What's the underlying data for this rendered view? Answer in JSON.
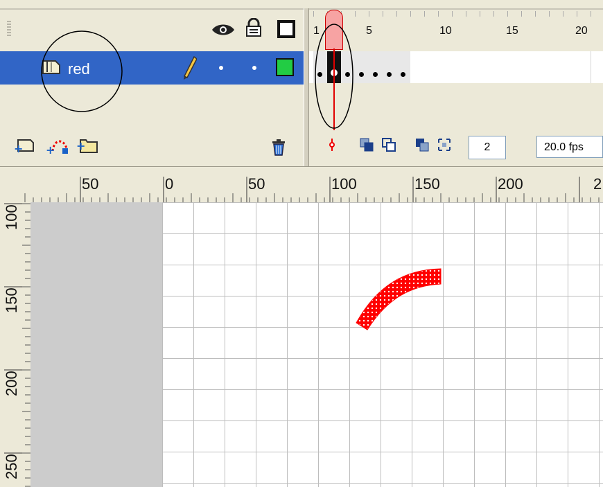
{
  "timeline": {
    "header": {
      "eye_icon": "eye-icon",
      "lock_icon": "lock-icon",
      "outline_icon": "outline-square-icon"
    },
    "frame_numbers": [
      "1",
      "5",
      "10",
      "15",
      "20"
    ],
    "layers": [
      {
        "name": "red",
        "current_frame_count": 7,
        "outline_color": "#22cc44",
        "selected": true
      }
    ],
    "toolbar": {
      "current_frame": "2",
      "frame_rate": "20.0 fps"
    }
  },
  "ruler": {
    "horizontal_labels": [
      "50",
      "0",
      "50",
      "100",
      "150",
      "200",
      "2"
    ],
    "vertical_labels": [
      "100",
      "150",
      "200",
      "250"
    ]
  },
  "stage": {
    "shape": "red-dotted-arc",
    "shape_color": "#ff0000"
  },
  "annotations": {
    "circle_color": "#000000"
  }
}
